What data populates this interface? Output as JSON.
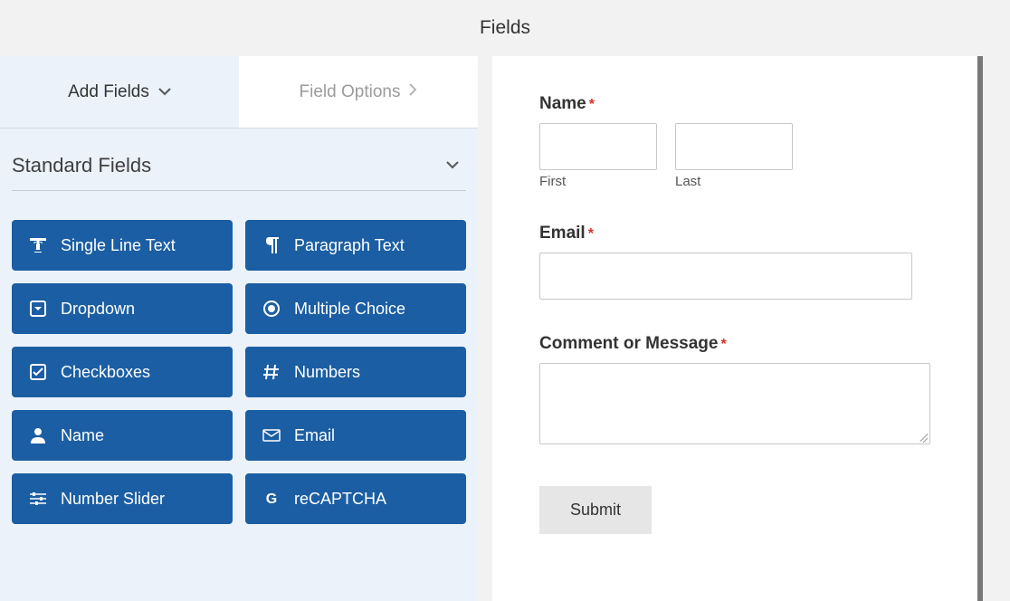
{
  "header": {
    "title": "Fields"
  },
  "tabs": {
    "add_fields": "Add Fields",
    "field_options": "Field Options"
  },
  "section": {
    "title": "Standard Fields"
  },
  "fields": [
    {
      "label": "Single Line Text",
      "icon": "text-icon"
    },
    {
      "label": "Paragraph Text",
      "icon": "paragraph-icon"
    },
    {
      "label": "Dropdown",
      "icon": "dropdown-icon"
    },
    {
      "label": "Multiple Choice",
      "icon": "radio-icon"
    },
    {
      "label": "Checkboxes",
      "icon": "checkbox-icon"
    },
    {
      "label": "Numbers",
      "icon": "hash-icon"
    },
    {
      "label": "Name",
      "icon": "user-icon"
    },
    {
      "label": "Email",
      "icon": "envelope-icon"
    },
    {
      "label": "Number Slider",
      "icon": "sliders-icon"
    },
    {
      "label": "reCAPTCHA",
      "icon": "recaptcha-icon"
    }
  ],
  "form": {
    "name_label": "Name",
    "first_sublabel": "First",
    "last_sublabel": "Last",
    "email_label": "Email",
    "comment_label": "Comment or Message",
    "submit_label": "Submit",
    "required_mark": "*"
  }
}
